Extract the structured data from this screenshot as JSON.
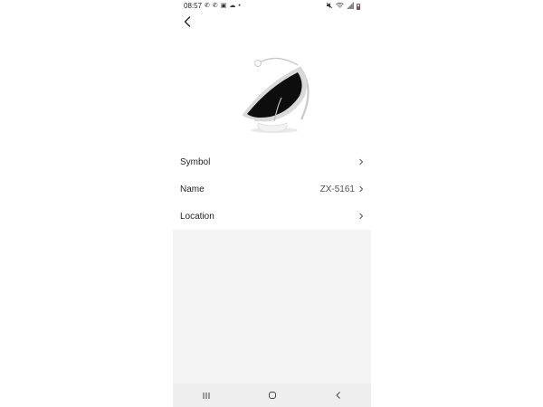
{
  "status_bar": {
    "time": "08:57",
    "left_icons": [
      "phone-icon",
      "phone-icon",
      "image-icon",
      "cloud-icon",
      "dot-icon"
    ],
    "right_icons": [
      "mute-icon",
      "wifi-icon",
      "signal-icon",
      "battery-icon"
    ]
  },
  "header": {
    "back_icon": "chevron-left-icon"
  },
  "product": {
    "image": "baby-bouncer-seat"
  },
  "settings": {
    "items": [
      {
        "label": "Symbol",
        "value": ""
      },
      {
        "label": "Name",
        "value": "ZX-5161"
      },
      {
        "label": "Location",
        "value": ""
      }
    ]
  },
  "navigation": {
    "buttons": [
      "recent-apps-icon",
      "home-icon",
      "back-icon"
    ]
  }
}
